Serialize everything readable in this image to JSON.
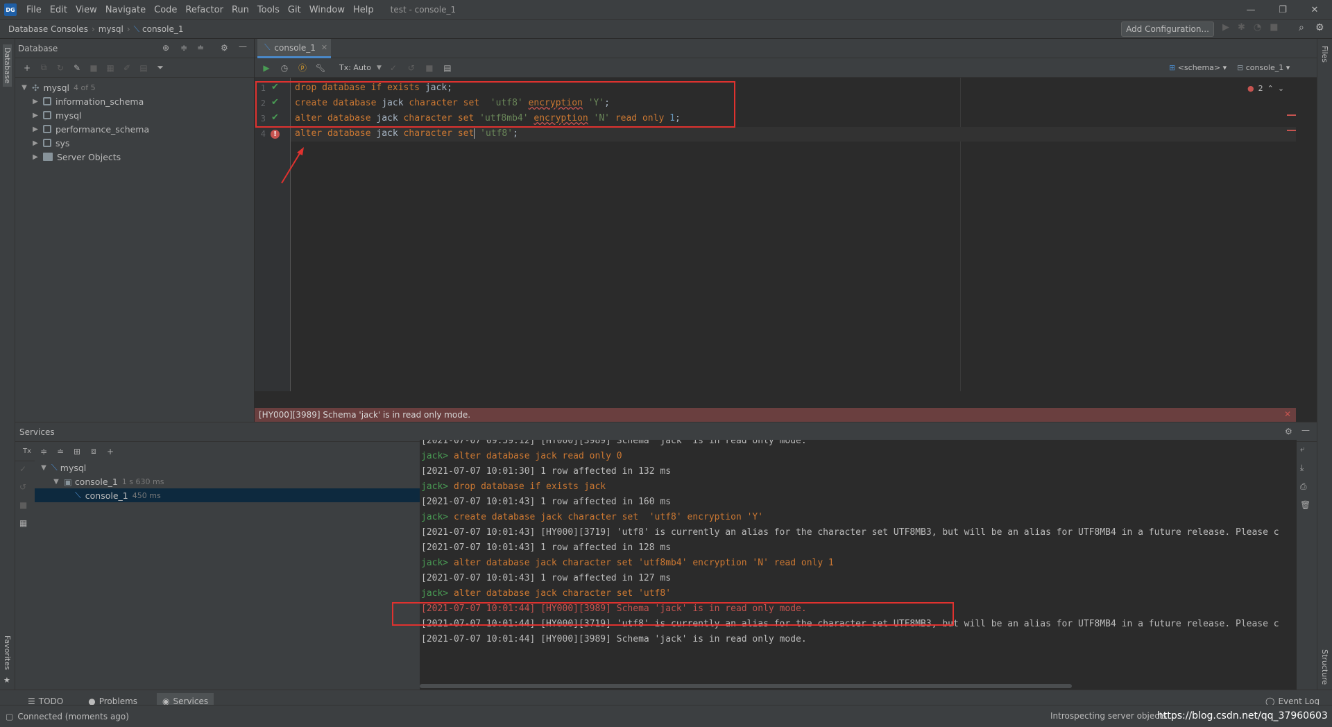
{
  "app": {
    "logo": "DG",
    "window_title": "test - console_1"
  },
  "menu": [
    "File",
    "Edit",
    "View",
    "Navigate",
    "Code",
    "Refactor",
    "Run",
    "Tools",
    "Git",
    "Window",
    "Help"
  ],
  "breadcrumb": [
    "Database Consoles",
    "mysql",
    "console_1"
  ],
  "toolbar": {
    "add_configuration": "Add Configuration..."
  },
  "database_panel": {
    "title": "Database",
    "root": {
      "name": "mysql",
      "count": "4 of 5"
    },
    "items": [
      "information_schema",
      "mysql",
      "performance_schema",
      "sys",
      "Server Objects"
    ]
  },
  "editor": {
    "tab": "console_1",
    "tx_mode": "Tx: Auto",
    "schema_selector": "<schema>",
    "console_selector": "console_1",
    "error_count": "2",
    "lines": [
      {
        "no": "1",
        "status": "ok",
        "text": "drop database if exists jack;"
      },
      {
        "no": "2",
        "status": "ok",
        "text": "create database jack character set  'utf8' encryption 'Y';"
      },
      {
        "no": "3",
        "status": "ok",
        "text": "alter database jack character set 'utf8mb4' encryption 'N' read only 1;"
      },
      {
        "no": "4",
        "status": "error",
        "text": "alter database jack character set 'utf8';"
      }
    ],
    "error_message": "[HY000][3989] Schema 'jack' is in read only mode."
  },
  "services": {
    "title": "Services",
    "tree": [
      {
        "name": "mysql",
        "time": ""
      },
      {
        "name": "console_1",
        "time": "1 s 630 ms"
      },
      {
        "name": "console_1",
        "time": "450 ms"
      }
    ],
    "output": [
      {
        "t": "log",
        "text": "[2021-07-07 09:59:12] [HY000][3989] Schema 'jack' is in read only mode."
      },
      {
        "t": "cmd",
        "prompt": "jack>",
        "text": "alter database jack read only 0"
      },
      {
        "t": "log",
        "text": "[2021-07-07 10:01:30] 1 row affected in 132 ms"
      },
      {
        "t": "cmd",
        "prompt": "jack>",
        "text": "drop database if exists jack"
      },
      {
        "t": "log",
        "text": "[2021-07-07 10:01:43] 1 row affected in 160 ms"
      },
      {
        "t": "cmd",
        "prompt": "jack>",
        "text": "create database jack character set  'utf8' encryption 'Y'"
      },
      {
        "t": "log",
        "text": "[2021-07-07 10:01:43] [HY000][3719] 'utf8' is currently an alias for the character set UTF8MB3, but will be an alias for UTF8MB4 in a future release. Please c"
      },
      {
        "t": "log",
        "text": "[2021-07-07 10:01:43] 1 row affected in 128 ms"
      },
      {
        "t": "cmd",
        "prompt": "jack>",
        "text": "alter database jack character set 'utf8mb4' encryption 'N' read only 1"
      },
      {
        "t": "log",
        "text": "[2021-07-07 10:01:43] 1 row affected in 127 ms"
      },
      {
        "t": "cmd",
        "prompt": "jack>",
        "text": "alter database jack character set 'utf8'"
      },
      {
        "t": "err",
        "text": "[2021-07-07 10:01:44] [HY000][3989] Schema 'jack' is in read only mode."
      },
      {
        "t": "log",
        "text": "[2021-07-07 10:01:44] [HY000][3719] 'utf8' is currently an alias for the character set UTF8MB3, but will be an alias for UTF8MB4 in a future release. Please c"
      },
      {
        "t": "log",
        "text": "[2021-07-07 10:01:44] [HY000][3989] Schema 'jack' is in read only mode."
      }
    ]
  },
  "bottom_tabs": [
    "TODO",
    "Problems",
    "Services"
  ],
  "event_log": "Event Log",
  "status": {
    "left": "Connected (moments ago)",
    "right": "Introspecting server objects...",
    "watermark": "https://blog.csdn.net/qq_37960603"
  },
  "side_labels": {
    "database": "Database",
    "favorites": "Favorites",
    "files": "Files",
    "structure": "Structure"
  }
}
